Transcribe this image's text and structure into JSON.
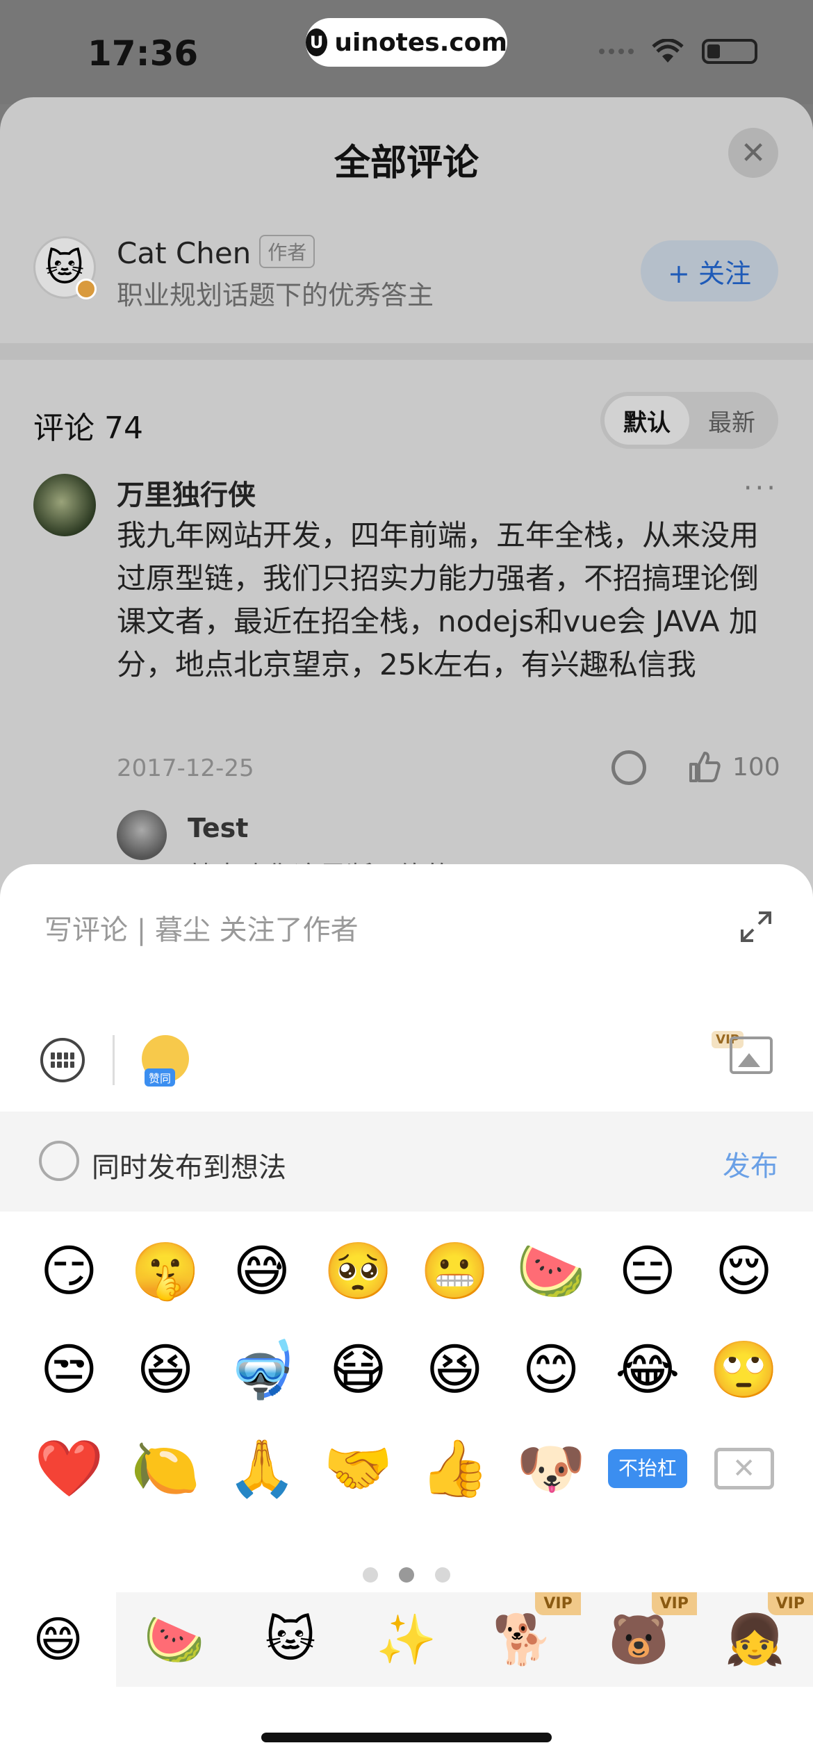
{
  "status_bar": {
    "time": "17:36",
    "url": "uinotes.com",
    "url_logo": "U"
  },
  "sheet": {
    "title": "全部评论",
    "close_icon": "✕",
    "author": {
      "avatar_icon": "🐱",
      "name": "Cat Chen",
      "tag": "作者",
      "description": "职业规划话题下的优秀答主",
      "follow_label": "+ 关注"
    },
    "comments_label": "评论 74",
    "sort": {
      "default": "默认",
      "latest": "最新"
    },
    "comment": {
      "user": "万里独行侠",
      "more": "···",
      "text": "我九年网站开发，四年前端，五年全栈，从来没用过原型链，我们只招实力能力强者，不招搞理论倒课文者，最近在招全栈，nodejs和vue会 JAVA 加分，地点北京望京，25k左右，有兴趣私信我",
      "date": "2017-12-25",
      "likes": "100",
      "reply": {
        "user": "Test",
        "text": "就喜欢你这果断干练的"
      }
    }
  },
  "composer": {
    "placeholder": "写评论 | 暮尘 关注了作者",
    "sticker_tag": "赞同",
    "image_vip": "VIP",
    "sync_label": "同时发布到想法",
    "publish_label": "发布",
    "emojis": [
      "😏",
      "🤫",
      "😅",
      "🥺",
      "😬",
      "🍉",
      "😑",
      "😌",
      "😒",
      "😆",
      "🤿",
      "😷",
      "😆",
      "😊",
      "😂",
      "🙄",
      "❤️",
      "🍋",
      "🙏",
      "🤝",
      "👍",
      "🐶",
      "不抬杠"
    ],
    "delete_icon": "✕",
    "page_count": 3,
    "active_page": 1,
    "packs": [
      {
        "icon": "😄",
        "vip": ""
      },
      {
        "icon": "🍉",
        "vip": ""
      },
      {
        "icon": "🐱",
        "vip": ""
      },
      {
        "icon": "✨",
        "vip": ""
      },
      {
        "icon": "🐕",
        "vip": "VIP"
      },
      {
        "icon": "🐻",
        "vip": "VIP"
      },
      {
        "icon": "👧",
        "vip": "VIP"
      }
    ]
  }
}
